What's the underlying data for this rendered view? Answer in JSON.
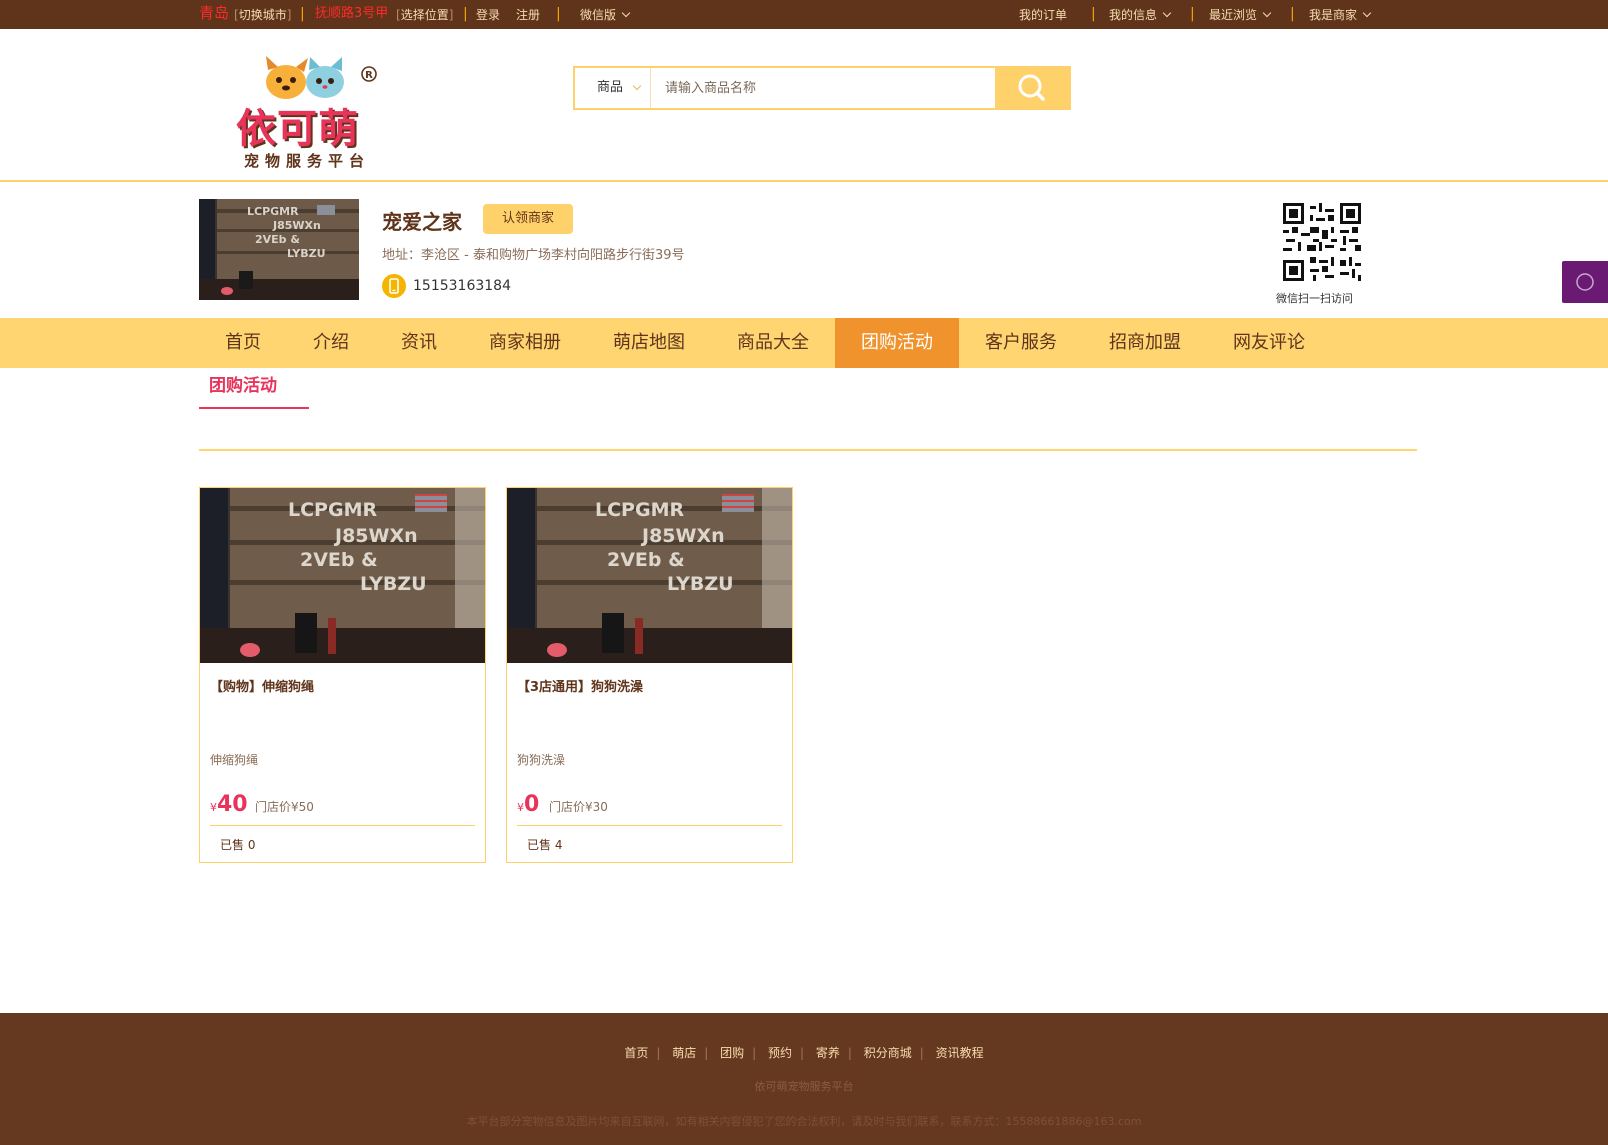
{
  "topbar": {
    "city": "青岛",
    "switch_city": "切换城市",
    "location": "抚顺路3号甲",
    "choose_location": "选择位置",
    "login": "登录",
    "register": "注册",
    "wechat": "微信版",
    "my_orders": "我的订单",
    "my_info": "我的信息",
    "recent": "最近浏览",
    "merchant": "我是商家"
  },
  "search": {
    "category": "商品",
    "placeholder": "请输入商品名称"
  },
  "shop": {
    "name": "宠爱之家",
    "claim": "认领商家",
    "address": "地址：李沧区 - 泰和购物广场李村向阳路步行街39号",
    "phone": "15153163184",
    "qr_label": "微信扫一扫访问"
  },
  "nav": {
    "items": [
      {
        "label": "首页"
      },
      {
        "label": "介绍"
      },
      {
        "label": "资讯"
      },
      {
        "label": "商家相册"
      },
      {
        "label": "萌店地图"
      },
      {
        "label": "商品大全"
      },
      {
        "label": "团购活动"
      },
      {
        "label": "客户服务"
      },
      {
        "label": "招商加盟"
      },
      {
        "label": "网友评论"
      }
    ],
    "active_index": 6
  },
  "section": {
    "title": "团购活动"
  },
  "products": [
    {
      "title": "【购物】伸缩狗绳",
      "desc": "伸缩狗绳",
      "currency": "¥",
      "price": "40",
      "original": "门店价¥50",
      "sold": "已售 0"
    },
    {
      "title": "【3店通用】狗狗洗澡",
      "desc": "狗狗洗澡",
      "currency": "¥",
      "price": "0",
      "original": "门店价¥30",
      "sold": "已售 4"
    }
  ],
  "footer": {
    "links": [
      "首页",
      "萌店",
      "团购",
      "预约",
      "寄养",
      "积分商城",
      "资讯教程"
    ],
    "platform": "依可萌宠物服务平台",
    "disclaimer": "本平台部分宠物信息及图片均来自互联网，如有相关内容侵犯了您的合法权利，请及时与我们联系，联系方式：15588661886@163.com"
  },
  "logo": {
    "brand": "依可萌",
    "tagline": "宠物服务平台"
  },
  "colors": {
    "topbar": "#5f341b",
    "accent_yellow": "#ffd572",
    "active_tab": "#f0932c",
    "price_pink": "#e8345b",
    "footer": "#653820"
  }
}
